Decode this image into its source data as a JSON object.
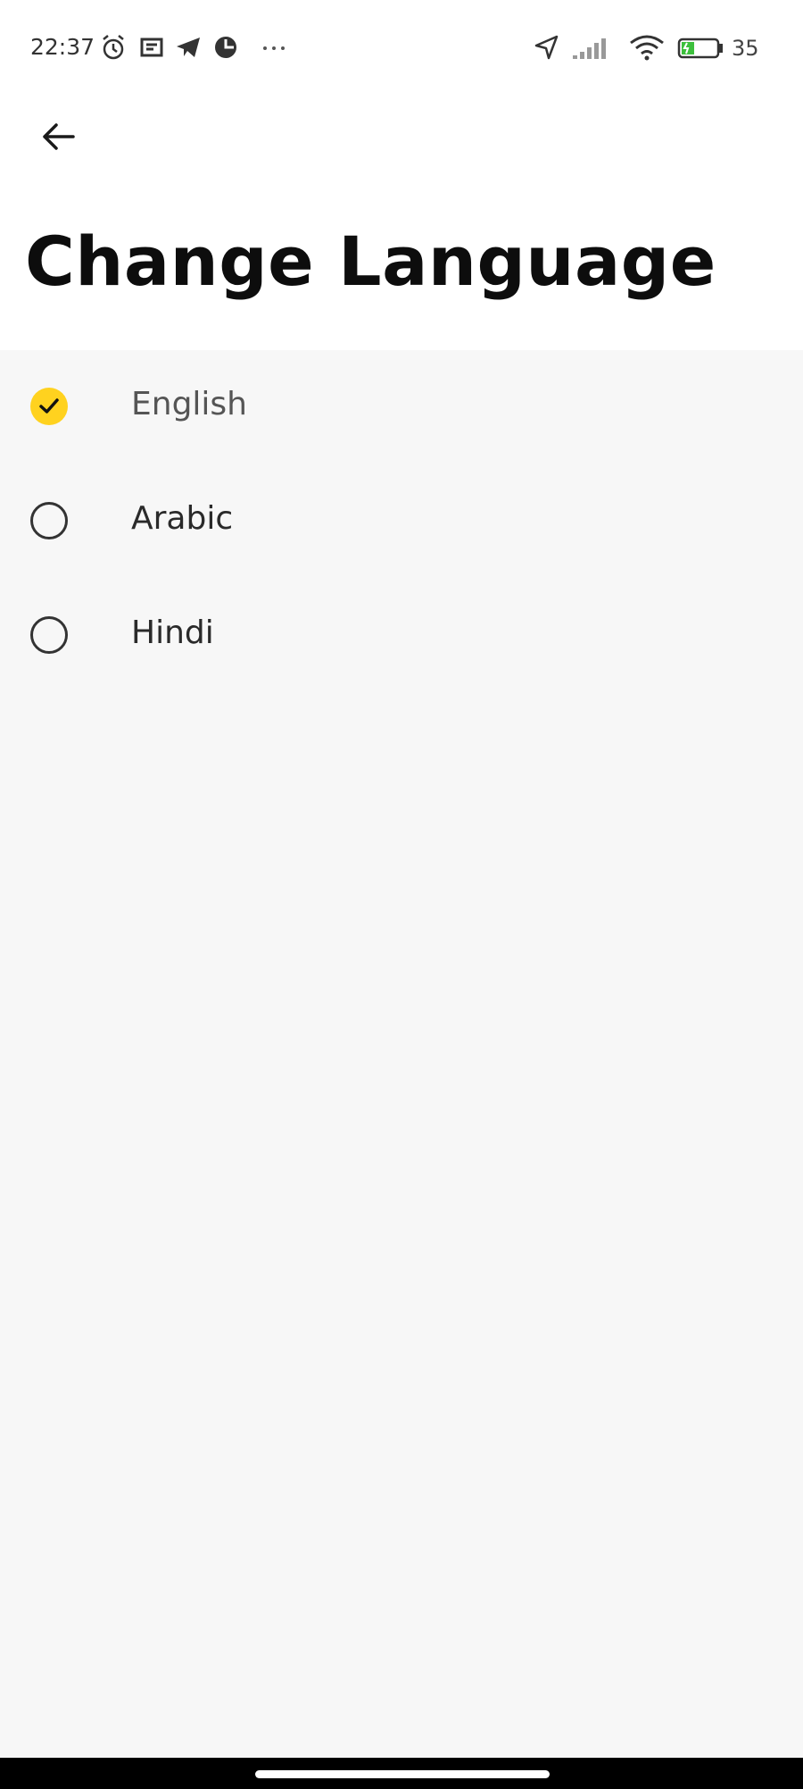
{
  "status_bar": {
    "time": "22:37",
    "battery_percent": "35",
    "icons": [
      "alarm-icon",
      "notification-icon",
      "telegram-icon",
      "app-icon",
      "more-dots-icon",
      "location-icon",
      "signal-icon",
      "wifi-icon",
      "battery-icon"
    ]
  },
  "header": {
    "back_icon": "arrow-left-icon",
    "title": "Change Language"
  },
  "languages": [
    {
      "label": "English",
      "selected": true
    },
    {
      "label": "Arabic",
      "selected": false
    },
    {
      "label": "Hindi",
      "selected": false
    }
  ],
  "colors": {
    "accent": "#ffd21f",
    "background": "#f7f7f7",
    "header_background": "#ffffff"
  }
}
